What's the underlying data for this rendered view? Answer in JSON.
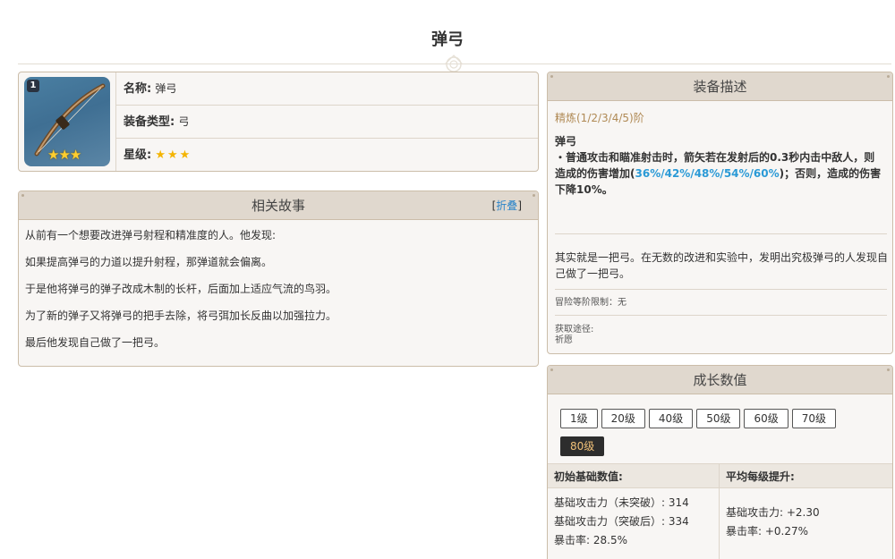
{
  "page": {
    "title": "弹弓"
  },
  "info": {
    "badge": "1",
    "name_label": "名称:",
    "name_value": "弹弓",
    "type_label": "装备类型:",
    "type_value": "弓",
    "rarity_label": "星级:",
    "rarity_stars": "★★★",
    "image_stars": "★★★"
  },
  "story": {
    "title": "相关故事",
    "collapse_open": "[",
    "collapse_label": "折叠",
    "collapse_close": "]",
    "paragraphs": [
      "从前有一个想要改进弹弓射程和精准度的人。他发现:",
      "如果提高弹弓的力道以提升射程，那弹道就会偏离。",
      "于是他将弹弓的弹子改成木制的长杆，后面加上适应气流的鸟羽。",
      "为了新的弹子又将弹弓的把手去除，将弓弭加长反曲以加强拉力。",
      "最后他发现自己做了一把弓。"
    ]
  },
  "description": {
    "title": "装备描述",
    "refine": "精炼(1/2/3/4/5)阶",
    "skill_name": "弹弓",
    "skill_text_1": "・普通攻击和瞄准射击时，箭矢若在发射后的0.3秒内击中敌人，则造成的伤害增加(",
    "skill_highlight": "36%/42%/48%/54%/60%",
    "skill_text_2": ")；否则，造成的伤害下降10%。",
    "lore": "其实就是一把弓。在无数的改进和实验中，发明出究极弹弓的人发现自己做了一把弓。",
    "level_limit": "冒险等阶限制：无",
    "source_label": "获取途径:",
    "source_value": "祈愿"
  },
  "growth": {
    "title": "成长数值",
    "levels": [
      "1级",
      "20级",
      "40级",
      "50级",
      "60级",
      "70级",
      "80级"
    ],
    "active_level": "80级",
    "base_header": "初始基础数值:",
    "per_level_header": "平均每级提升:",
    "base_atk_pre": "基础攻击力（未突破）: 314",
    "base_atk_post": "基础攻击力（突破后）: 334",
    "base_crit": "暴击率: 28.5%",
    "inc_atk": "基础攻击力: +2.30",
    "inc_crit": "暴击率: +0.27%"
  },
  "colors": {
    "accent_blue": "#2b9ad6",
    "refine_gold": "#b08a55",
    "panel_header": "#e0d8ce",
    "active_level_text": "#f0c078"
  }
}
